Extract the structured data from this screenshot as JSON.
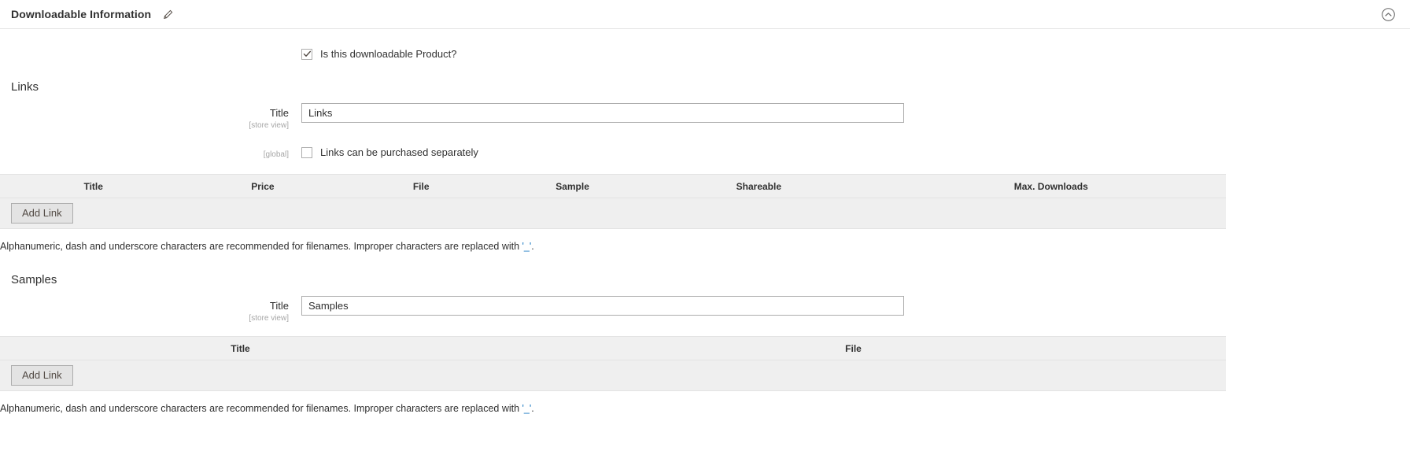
{
  "header": {
    "title": "Downloadable Information",
    "edit_icon": "pencil-icon",
    "collapse_icon": "chevron-up-circle-icon"
  },
  "downloadable_toggle": {
    "label": "Is this downloadable Product?",
    "checked": true
  },
  "links": {
    "section_title": "Links",
    "title_field": {
      "label": "Title",
      "scope": "[store view]",
      "value": "Links",
      "placeholder": ""
    },
    "purchase_separately": {
      "scope": "[global]",
      "label": "Links can be purchased separately",
      "checked": false
    },
    "table": {
      "columns": [
        "Title",
        "Price",
        "File",
        "Sample",
        "Shareable",
        "Max. Downloads"
      ],
      "rows": [],
      "add_button": "Add Link"
    },
    "note": {
      "before": "Alphanumeric, dash and underscore characters are recommended for filenames. Improper characters are replaced with ",
      "quoted": "'_'",
      "after": "."
    }
  },
  "samples": {
    "section_title": "Samples",
    "title_field": {
      "label": "Title",
      "scope": "[store view]",
      "value": "Samples",
      "placeholder": ""
    },
    "table": {
      "columns": [
        "Title",
        "File"
      ],
      "rows": [],
      "add_button": "Add Link"
    },
    "note": {
      "before": "Alphanumeric, dash and underscore characters are recommended for filenames. Improper characters are replaced with ",
      "quoted": "'_'",
      "after": "."
    }
  },
  "colors": {
    "text": "#303030",
    "scope": "#a6a6a6",
    "link": "#1979c3",
    "grid_header_bg": "#f0f0f0",
    "grid_row_bg": "#efefef",
    "border": "#adadad"
  }
}
